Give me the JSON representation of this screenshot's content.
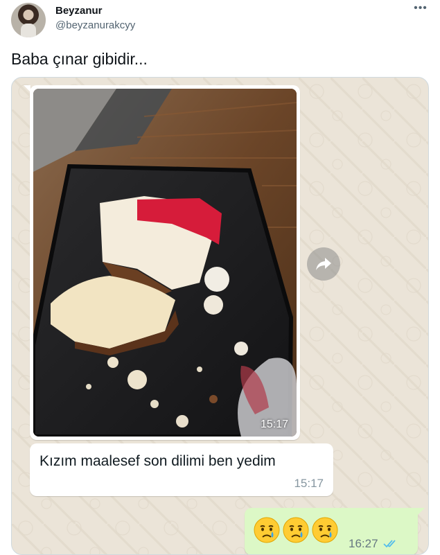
{
  "tweet": {
    "author_name": "Beyzanur",
    "author_handle": "@beyzanurakcyy",
    "more_label": "•••",
    "text": "Baba çınar gibidir..."
  },
  "chat": {
    "image_message": {
      "time": "15:17"
    },
    "text_message": {
      "text": "Kızım maalesef son dilimi ben yedim",
      "time": "15:17"
    },
    "sent_message": {
      "emojis": [
        "crying-face",
        "crying-face",
        "crying-face"
      ],
      "time": "16:27",
      "status": "read"
    }
  },
  "colors": {
    "chat_background": "#ebe4d8",
    "incoming_bubble": "#ffffff",
    "outgoing_bubble": "#dcf8c6",
    "read_ticks": "#53bdeb"
  }
}
